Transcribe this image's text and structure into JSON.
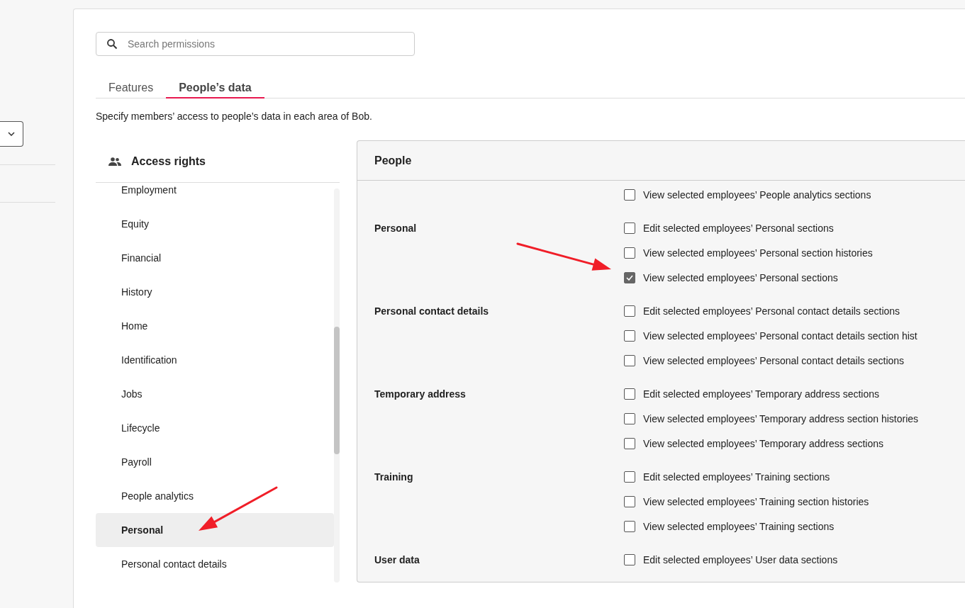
{
  "search": {
    "placeholder": "Search permissions"
  },
  "tabs": [
    {
      "label": "Features",
      "selected": false
    },
    {
      "label": "People’s data",
      "selected": true
    }
  ],
  "description": "Specify members’ access to people’s data in each area of Bob.",
  "access_rights": {
    "title": "Access rights",
    "items": [
      {
        "label": "Employment",
        "selected": false
      },
      {
        "label": "Equity",
        "selected": false
      },
      {
        "label": "Financial",
        "selected": false
      },
      {
        "label": "History",
        "selected": false
      },
      {
        "label": "Home",
        "selected": false
      },
      {
        "label": "Identification",
        "selected": false
      },
      {
        "label": "Jobs",
        "selected": false
      },
      {
        "label": "Lifecycle",
        "selected": false
      },
      {
        "label": "Payroll",
        "selected": false
      },
      {
        "label": "People analytics",
        "selected": false
      },
      {
        "label": "Personal",
        "selected": true
      },
      {
        "label": "Personal contact details",
        "selected": false
      }
    ]
  },
  "panel": {
    "title": "People",
    "groups": [
      {
        "options": [
          {
            "label": "View selected employees’ People analytics sections",
            "checked": false
          }
        ]
      },
      {
        "label": "Personal",
        "options": [
          {
            "label": "Edit selected employees’ Personal sections",
            "checked": false
          },
          {
            "label": "View selected employees’ Personal section histories",
            "checked": false
          },
          {
            "label": "View selected employees’ Personal sections",
            "checked": true
          }
        ]
      },
      {
        "label": "Personal contact details",
        "options": [
          {
            "label": "Edit selected employees’ Personal contact details sections",
            "checked": false
          },
          {
            "label": "View selected employees’ Personal contact details section hist",
            "checked": false
          },
          {
            "label": "View selected employees’ Personal contact details sections",
            "checked": false
          }
        ]
      },
      {
        "label": "Temporary address",
        "options": [
          {
            "label": "Edit selected employees’ Temporary address sections",
            "checked": false
          },
          {
            "label": "View selected employees’ Temporary address section histories",
            "checked": false
          },
          {
            "label": "View selected employees’ Temporary address sections",
            "checked": false
          }
        ]
      },
      {
        "label": "Training",
        "options": [
          {
            "label": "Edit selected employees’ Training sections",
            "checked": false
          },
          {
            "label": "View selected employees’ Training section histories",
            "checked": false
          },
          {
            "label": "View selected employees’ Training sections",
            "checked": false
          }
        ]
      },
      {
        "label": "User data",
        "options": [
          {
            "label": "Edit selected employees’ User data sections",
            "checked": false
          }
        ]
      }
    ]
  }
}
